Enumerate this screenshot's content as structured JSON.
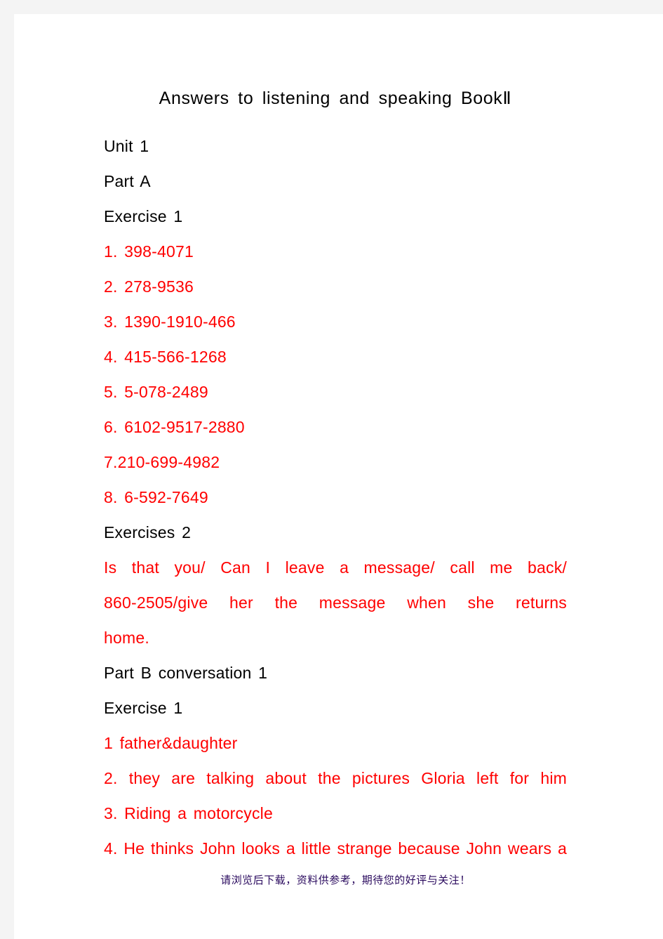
{
  "page": {
    "title": "Answers to listening and speaking BookⅡ",
    "background_color": "#FFFFFF",
    "edge_color": "#F4F4F4",
    "black_text_color": "#000000",
    "red_text_color": "#FF0000",
    "footer_text_color": "#2A0A5E"
  },
  "body": {
    "headings": {
      "unit": "Unit 1",
      "part_a": "Part A",
      "exercise_1": "Exercise 1",
      "exercises_2": "Exercises 2",
      "part_b": "Part B conversation 1",
      "exercise_1_b": "Exercise 1"
    },
    "part_a_exercise_1_answers": [
      "1. 398-4071",
      "2. 278-9536",
      "3. 1390-1910-466",
      "4. 415-566-1268",
      "5. 5-078-2489",
      "6. 6102-9517-2880",
      "7.210-699-4982",
      "8. 6-592-7649"
    ],
    "part_a_exercises_2_answer": {
      "line_1": "Is that you/ Can I leave a message/ call me back/",
      "line_2": "860-2505/give her the message when she returns",
      "line_3": "home."
    },
    "part_b_exercise_1_answers": {
      "item_1": "1 father&daughter",
      "item_2": "2. they are talking about the pictures Gloria left for him",
      "item_3": "3. Riding a motorcycle",
      "item_4": "4. He thinks John looks a little strange because John wears a"
    }
  },
  "footer": {
    "notice": "请浏览后下载，资料供参考，期待您的好评与关注！"
  }
}
